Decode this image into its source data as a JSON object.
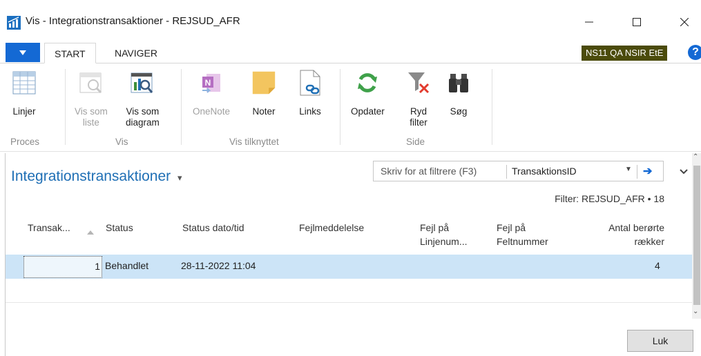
{
  "window": {
    "title": "Vis - Integrationstransaktioner - REJSUD_AFR",
    "icon": "dynamics-nav-icon",
    "minimize": "—",
    "maximize": "☐",
    "close": "✕"
  },
  "ribbon_tabs": {
    "app_menu": "▼",
    "items": [
      {
        "label": "START",
        "active": true
      },
      {
        "label": "NAVIGER",
        "active": false
      }
    ],
    "company": "NS11 QA NSIR EtE",
    "help": "?"
  },
  "ribbon": {
    "buttons": [
      {
        "id": "linjer",
        "label": "Linjer",
        "icon": "grid-icon",
        "enabled": true
      },
      {
        "id": "vis-som-liste",
        "label": "Vis som\nliste",
        "icon": "list-view-icon",
        "enabled": false
      },
      {
        "id": "vis-som-diagram",
        "label": "Vis som\ndiagram",
        "icon": "chart-view-icon",
        "enabled": true
      },
      {
        "id": "onenote",
        "label": "OneNote",
        "icon": "onenote-icon",
        "enabled": false
      },
      {
        "id": "noter",
        "label": "Noter",
        "icon": "note-icon",
        "enabled": true
      },
      {
        "id": "links",
        "label": "Links",
        "icon": "link-icon",
        "enabled": true
      },
      {
        "id": "opdater",
        "label": "Opdater",
        "icon": "refresh-icon",
        "enabled": true
      },
      {
        "id": "ryd-filter",
        "label": "Ryd\nfilter",
        "icon": "clear-filter-icon",
        "enabled": true
      },
      {
        "id": "sog",
        "label": "Søg",
        "icon": "binoculars-icon",
        "enabled": true
      }
    ],
    "groups": [
      "Proces",
      "Vis",
      "Vis tilknyttet",
      "Side"
    ]
  },
  "page": {
    "title": "Integrationstransaktioner",
    "title_menu": "▾",
    "filter_placeholder": "Skriv for at filtrere (F3)",
    "filter_field": "TransaktionsID",
    "filter_summary": "Filter: REJSUD_AFR • 18"
  },
  "table": {
    "columns": [
      "Transak...",
      "Status",
      "Status dato/tid",
      "Fejlmeddelelse",
      "Fejl på\nLinjenum...",
      "Fejl på\nFeltnummer",
      "Antal berørte\nrække r"
    ],
    "column_labels": {
      "transak": "Transak...",
      "status": "Status",
      "status_dato": "Status dato/tid",
      "fejlmeddelelse": "Fejlmeddelelse",
      "fejl_linje_1": "Fejl på",
      "fejl_linje_2": "Linjenum...",
      "fejl_felt_1": "Fejl på",
      "fejl_felt_2": "Feltnummer",
      "antal_1": "Antal berørte",
      "antal_2": "rækker"
    },
    "rows": [
      {
        "transaktions_id": "1",
        "status": "Behandlet",
        "status_dato_tid": "28-11-2022 11:04",
        "fejlmeddelelse": "",
        "fejl_linjenummer": "",
        "fejl_feltnummer": "",
        "antal_berorte_raekker": "4"
      }
    ]
  },
  "footer": {
    "close_label": "Luk"
  },
  "colors": {
    "accent_blue": "#1469d4",
    "title_blue": "#1f6fb5",
    "selected_row": "#cce4f7",
    "company_badge": "#4b4b0b"
  }
}
